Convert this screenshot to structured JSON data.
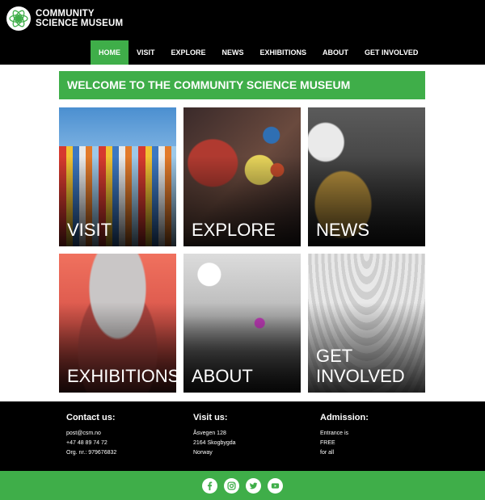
{
  "brand": {
    "line1": "COMMUNITY",
    "line2": "SCIENCE MUSEUM"
  },
  "nav": {
    "items": [
      {
        "label": "HOME"
      },
      {
        "label": "VISIT"
      },
      {
        "label": "EXPLORE"
      },
      {
        "label": "NEWS"
      },
      {
        "label": "EXHIBITIONS"
      },
      {
        "label": "ABOUT"
      },
      {
        "label": "GET INVOLVED"
      }
    ],
    "active": "HOME"
  },
  "welcome": {
    "title": "WELCOME TO THE COMMUNITY SCIENCE MUSEUM"
  },
  "tiles": [
    {
      "label": "VISIT",
      "image": "museum-facade-photo"
    },
    {
      "label": "EXPLORE",
      "image": "science-exhibit-photo"
    },
    {
      "label": "NEWS",
      "image": "astronaut-photo"
    },
    {
      "label": "EXHIBITIONS",
      "image": "vr-headset-photo"
    },
    {
      "label": "ABOUT",
      "image": "gallery-interior-photo"
    },
    {
      "label": "GET\nINVOLVED",
      "image": "dome-hall-photo"
    }
  ],
  "footer": {
    "contact": {
      "title": "Contact us:",
      "lines": [
        "post@csm.no",
        "+47 48 89 74 72",
        "Org. nr.: 979676832"
      ]
    },
    "visit": {
      "title": "Visit us:",
      "lines": [
        "Åsvegen 128",
        "2164 Skogbygda",
        "Norway"
      ]
    },
    "admission": {
      "title": "Admission:",
      "lines": [
        "Entrance is",
        "FREE",
        "for all"
      ]
    }
  },
  "social": [
    "facebook-icon",
    "instagram-icon",
    "twitter-icon",
    "youtube-icon"
  ],
  "colors": {
    "accent": "#3fae49",
    "header": "#000000",
    "text": "#ffffff"
  }
}
